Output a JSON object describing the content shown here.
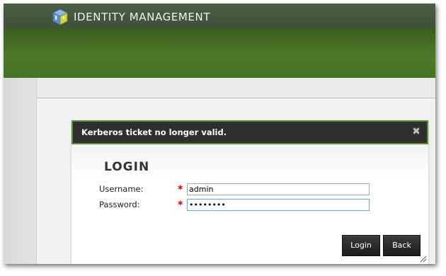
{
  "app": {
    "title": "IDENTITY MANAGEMENT",
    "logo_icon": "ipa-cube-logo-icon"
  },
  "dialog": {
    "title": "Kerberos ticket no longer valid.",
    "close_glyph": "✖",
    "close_icon": "close-icon",
    "heading": "LOGIN",
    "required_marker": "*",
    "fields": {
      "username": {
        "label": "Username:",
        "value": "admin"
      },
      "password": {
        "label": "Password:",
        "value": "••••••••"
      }
    },
    "buttons": {
      "login": "Login",
      "back": "Back"
    }
  },
  "colors": {
    "header_green": "#4d7a28",
    "header_top": "#46573f",
    "dialog_titlebar": "#2f2f2f",
    "dialog_border": "#5f8a3a",
    "required": "#d60000",
    "button_dark": "#2a2a2a"
  }
}
